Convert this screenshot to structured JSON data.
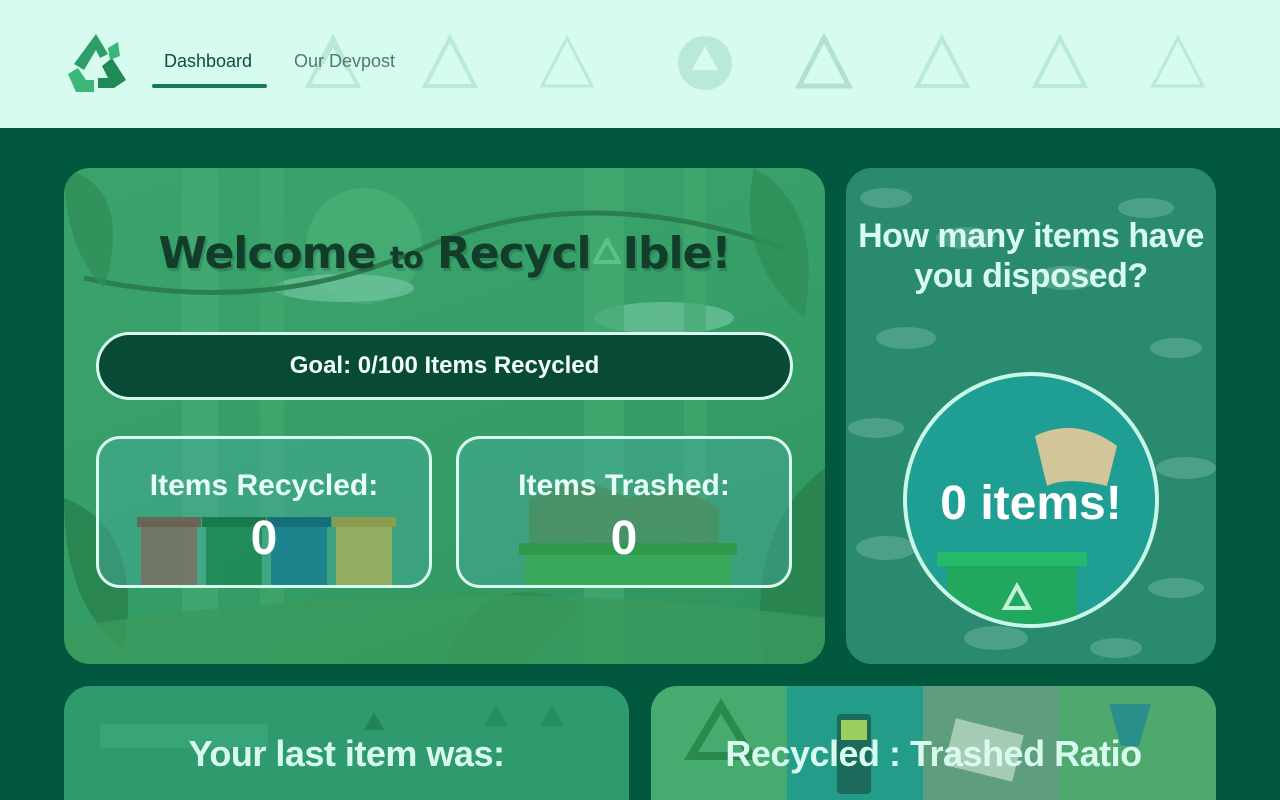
{
  "nav": {
    "tabs": [
      {
        "label": "Dashboard",
        "active": true
      },
      {
        "label": "Our Devpost",
        "active": false
      }
    ],
    "logo_icon": "recycle-icon"
  },
  "welcome": {
    "title_part1": "Welcome",
    "title_part2": "to",
    "title_part3": "Recycl",
    "title_part4": "ble!",
    "goal_text": "Goal: 0/100 Items Recycled",
    "recycled_label": "Items Recycled:",
    "recycled_value": "0",
    "trashed_label": "Items Trashed:",
    "trashed_value": "0"
  },
  "disposed": {
    "title": "How many items have you disposed?",
    "count_text": "0 items!"
  },
  "last_item": {
    "heading": "Your last item was:"
  },
  "ratio": {
    "heading": "Recycled : Trashed Ratio"
  },
  "colors": {
    "nav_bg": "#d8fbef",
    "page_bg": "#02573f",
    "accent": "#127a5a",
    "goal_bg": "#084a35"
  }
}
